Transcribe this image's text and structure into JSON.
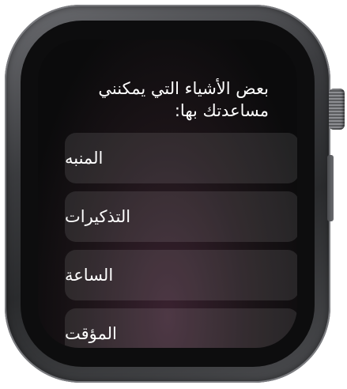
{
  "prompt": {
    "text": "بعض الأشياء التي يمكنني مساعدتك بها:"
  },
  "suggestions": [
    {
      "label": "المنبه",
      "icon": "alarm"
    },
    {
      "label": "التذكيرات",
      "icon": "reminders"
    },
    {
      "label": "الساعة",
      "icon": "clock"
    },
    {
      "label": "المؤقت",
      "icon": "timer"
    }
  ],
  "colors": {
    "screen_bg": "#0b0b0c",
    "item_bg": "#2a2a2c",
    "text": "#ffffff",
    "case": "#3a3b3e"
  }
}
